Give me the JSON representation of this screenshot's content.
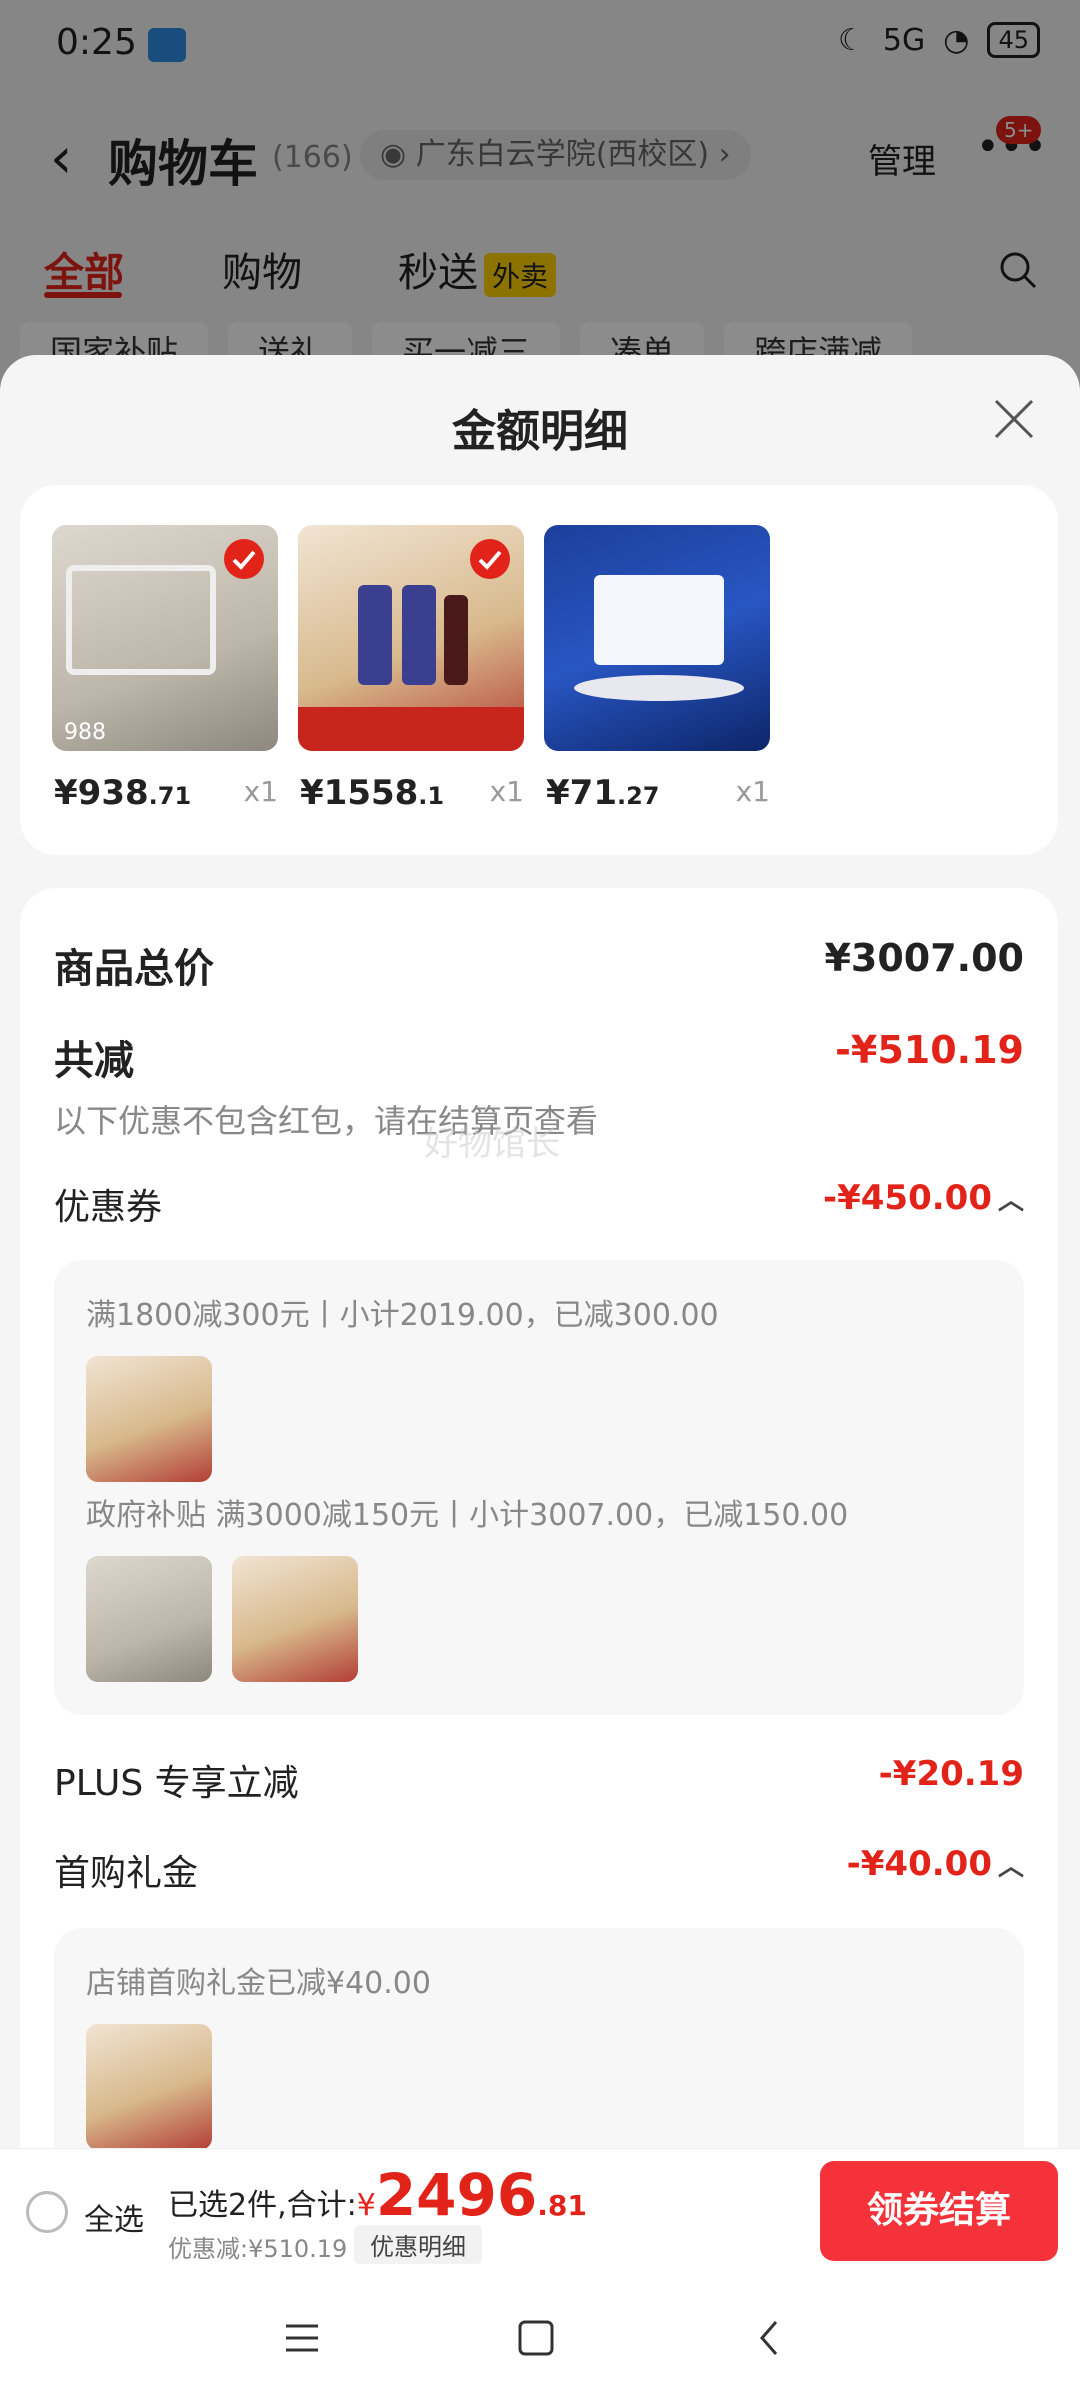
{
  "status": {
    "time": "0:25",
    "network": "5G",
    "battery": "45"
  },
  "header": {
    "title": "购物车",
    "count": "(166)",
    "address": "广东白云学院(西校区)",
    "manage": "管理",
    "badge": "5+"
  },
  "tabs": [
    {
      "label": "全部"
    },
    {
      "label": "购物"
    },
    {
      "label": "秒送"
    }
  ],
  "tab_badge": "外卖",
  "filters": [
    "国家补贴",
    "送礼",
    "买一减三",
    "凑单",
    "跨店满减"
  ],
  "sheet": {
    "title": "金额明细",
    "products": [
      {
        "price_int": "¥938",
        "price_dec": ".71",
        "qty": "x1",
        "checked": true,
        "thumb_text": "988"
      },
      {
        "price_int": "¥1558",
        "price_dec": ".1",
        "qty": "x1",
        "checked": true,
        "thumb_text": ""
      },
      {
        "price_int": "¥71",
        "price_dec": ".27",
        "qty": "x1",
        "checked": false,
        "thumb_text": ""
      }
    ],
    "total_label": "商品总价",
    "total_value": "¥3007.00",
    "reduce_label": "共减",
    "reduce_value": "-¥510.19",
    "reduce_note": "以下优惠不包含红包，请在结算页查看",
    "watermark": "好物馆长",
    "coupon_label": "优惠券",
    "coupon_value": "-¥450.00",
    "rule1": "满1800减300元丨小计2019.00，已减300.00",
    "rule2": "政府补贴 满3000减150元丨小计3007.00，已减150.00",
    "plus_label": "PLUS 专享立减",
    "plus_value": "-¥20.19",
    "gift_label": "首购礼金",
    "gift_value": "-¥40.00",
    "gift_rule": "店铺首购礼金已减¥40.00"
  },
  "bottom": {
    "select_all": "全选",
    "selected": "已选2件,合计:",
    "currency": "¥",
    "amount_int": "2496",
    "amount_dec": ".81",
    "discount": "优惠减:¥510.19",
    "detail": "优惠明细",
    "checkout": "领券结算"
  },
  "colors": {
    "accent": "#e2231a",
    "checkout": "#f5313a"
  }
}
